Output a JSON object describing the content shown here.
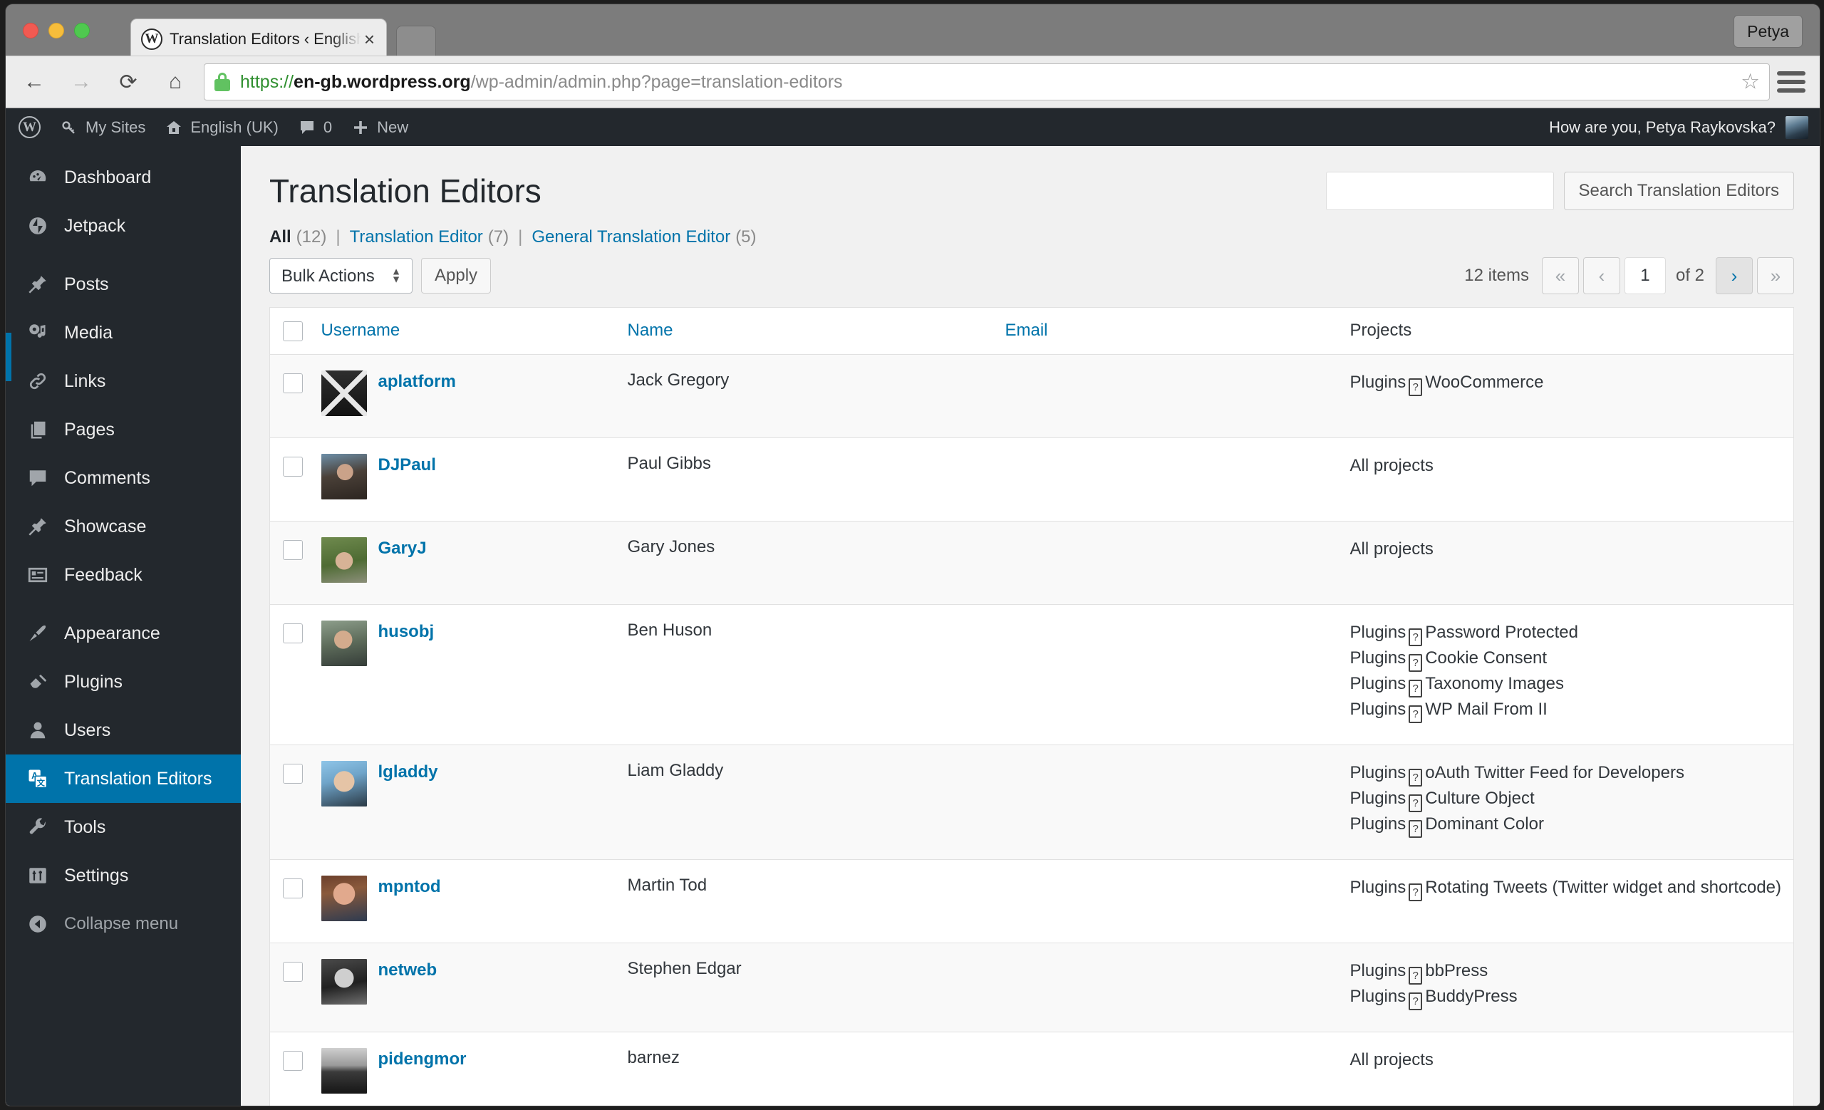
{
  "browser": {
    "tab": {
      "title": "Translation Editors ‹ English",
      "favicon": "wordpress-icon",
      "close": "×"
    },
    "new_tab_label": "+",
    "profile_button": "Petya",
    "nav": {
      "back": "←",
      "forward": "→",
      "reload": "⟳",
      "home": "⌂"
    },
    "url": {
      "scheme": "https://",
      "host": "en-gb.wordpress.org",
      "path": "/wp-admin/admin.php?page=translation-editors"
    },
    "bookmark_star": "☆",
    "menu_icon": "hamburger-icon"
  },
  "adminbar": {
    "logo": "W",
    "items": [
      {
        "icon": "key-icon",
        "label": "My Sites"
      },
      {
        "icon": "home-icon",
        "label": "English (UK)"
      },
      {
        "icon": "comment-icon",
        "label": "0"
      },
      {
        "icon": "plus-icon",
        "label": "New"
      }
    ],
    "greeting": "How are you, Petya Raykovska?"
  },
  "sidebar": {
    "items": [
      {
        "label": "Dashboard",
        "icon": "dashboard-icon",
        "current": false
      },
      {
        "label": "Jetpack",
        "icon": "jetpack-icon",
        "current": false
      },
      {
        "label": "Posts",
        "icon": "pin-icon",
        "current": false
      },
      {
        "label": "Media",
        "icon": "media-icon",
        "current": false
      },
      {
        "label": "Links",
        "icon": "link-icon",
        "current": false
      },
      {
        "label": "Pages",
        "icon": "pages-icon",
        "current": false
      },
      {
        "label": "Comments",
        "icon": "comment-icon",
        "current": false
      },
      {
        "label": "Showcase",
        "icon": "pin-icon",
        "current": false
      },
      {
        "label": "Feedback",
        "icon": "feedback-icon",
        "current": false
      },
      {
        "label": "Appearance",
        "icon": "brush-icon",
        "current": false
      },
      {
        "label": "Plugins",
        "icon": "plug-icon",
        "current": false
      },
      {
        "label": "Users",
        "icon": "user-icon",
        "current": false
      },
      {
        "label": "Translation Editors",
        "icon": "translation-icon",
        "current": true
      },
      {
        "label": "Tools",
        "icon": "wrench-icon",
        "current": false
      },
      {
        "label": "Settings",
        "icon": "settings-icon",
        "current": false
      }
    ],
    "collapse": {
      "label": "Collapse menu",
      "icon": "collapse-arrow-icon"
    }
  },
  "page": {
    "title": "Translation Editors",
    "filters": [
      {
        "label": "All",
        "count": "(12)",
        "current": true
      },
      {
        "label": "Translation Editor",
        "count": "(7)",
        "current": false
      },
      {
        "label": "General Translation Editor",
        "count": "(5)",
        "current": false
      }
    ],
    "filter_separator": "|"
  },
  "search": {
    "value": "",
    "placeholder": "",
    "button_label": "Search Translation Editors"
  },
  "tablenav": {
    "bulk_actions": {
      "selected": "Bulk Actions",
      "options": [
        "Bulk Actions"
      ]
    },
    "apply_label": "Apply",
    "items_count": "12 items",
    "first_label": "«",
    "prev_label": "‹",
    "current_page": "1",
    "total_pages_label": "of 2",
    "next_label": "›",
    "last_label": "»"
  },
  "table": {
    "columns": [
      {
        "key": "cb",
        "label": "",
        "sortable": false
      },
      {
        "key": "username",
        "label": "Username",
        "sortable": true
      },
      {
        "key": "name",
        "label": "Name",
        "sortable": true
      },
      {
        "key": "email",
        "label": "Email",
        "sortable": true
      },
      {
        "key": "projects",
        "label": "Projects",
        "sortable": false
      }
    ],
    "rows": [
      {
        "username": "aplatform",
        "name": "Jack Gregory",
        "email": "",
        "avatar": "av-aplatform",
        "projects": [
          "Plugins ▯ WooCommerce"
        ],
        "project_parts": [
          {
            "prefix": "Plugins",
            "name": "WooCommerce"
          }
        ]
      },
      {
        "username": "DJPaul",
        "name": "Paul Gibbs",
        "email": "",
        "avatar": "av-djpaul",
        "projects": [
          "All projects"
        ],
        "project_parts": [
          {
            "prefix": "",
            "name": "All projects"
          }
        ]
      },
      {
        "username": "GaryJ",
        "name": "Gary Jones",
        "email": "",
        "avatar": "av-garyj",
        "projects": [
          "All projects"
        ],
        "project_parts": [
          {
            "prefix": "",
            "name": "All projects"
          }
        ]
      },
      {
        "username": "husobj",
        "name": "Ben Huson",
        "email": "",
        "avatar": "av-husobj",
        "projects": [
          "Plugins ▯ Password Protected",
          "Plugins ▯ Cookie Consent",
          "Plugins ▯ Taxonomy Images",
          "Plugins ▯ WP Mail From II"
        ],
        "project_parts": [
          {
            "prefix": "Plugins",
            "name": "Password Protected"
          },
          {
            "prefix": "Plugins",
            "name": "Cookie Consent"
          },
          {
            "prefix": "Plugins",
            "name": "Taxonomy Images"
          },
          {
            "prefix": "Plugins",
            "name": "WP Mail From II"
          }
        ]
      },
      {
        "username": "lgladdy",
        "name": "Liam Gladdy",
        "email": "",
        "avatar": "av-lgladdy",
        "projects": [
          "Plugins ▯ oAuth Twitter Feed for Developers",
          "Plugins ▯ Culture Object",
          "Plugins ▯ Dominant Color"
        ],
        "project_parts": [
          {
            "prefix": "Plugins",
            "name": "oAuth Twitter Feed for Developers"
          },
          {
            "prefix": "Plugins",
            "name": "Culture Object"
          },
          {
            "prefix": "Plugins",
            "name": "Dominant Color"
          }
        ]
      },
      {
        "username": "mpntod",
        "name": "Martin Tod",
        "email": "",
        "avatar": "av-mpntod",
        "projects": [
          "Plugins ▯ Rotating Tweets (Twitter widget and shortcode)"
        ],
        "project_parts": [
          {
            "prefix": "Plugins",
            "name": "Rotating Tweets (Twitter widget and shortcode)"
          }
        ]
      },
      {
        "username": "netweb",
        "name": "Stephen Edgar",
        "email": "",
        "avatar": "av-netweb",
        "projects": [
          "Plugins ▯ bbPress",
          "Plugins ▯ BuddyPress"
        ],
        "project_parts": [
          {
            "prefix": "Plugins",
            "name": "bbPress"
          },
          {
            "prefix": "Plugins",
            "name": "BuddyPress"
          }
        ]
      },
      {
        "username": "pidengmor",
        "name": "barnez",
        "email": "",
        "avatar": "av-pidengmor",
        "projects": [
          "All projects"
        ],
        "project_parts": [
          {
            "prefix": "",
            "name": "All projects"
          }
        ]
      }
    ]
  },
  "colors": {
    "wp_blue": "#0073aa",
    "admin_dark": "#23282d",
    "link": "#0073aa",
    "page_bg": "#f1f1f1"
  }
}
